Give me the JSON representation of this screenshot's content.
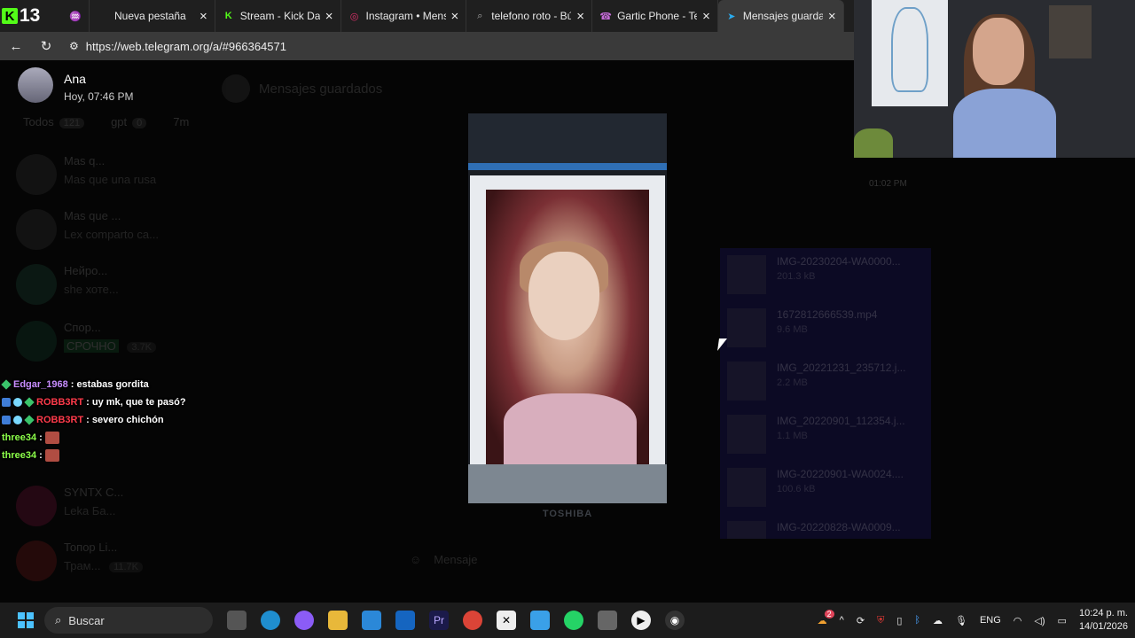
{
  "stream": {
    "kick_count": "13"
  },
  "tabs": [
    {
      "title": "Nueva pestaña",
      "icon": "new-tab-icon",
      "active": false
    },
    {
      "title": "Stream - Kick Dash",
      "icon": "kick-icon",
      "active": false
    },
    {
      "title": "Instagram • Mensa",
      "icon": "instagram-icon",
      "active": false
    },
    {
      "title": "telefono roto - Bús",
      "icon": "search-icon",
      "active": false
    },
    {
      "title": "Gartic Phone - Tele",
      "icon": "gartic-icon",
      "active": false
    },
    {
      "title": "Mensajes guardad",
      "icon": "telegram-icon",
      "active": true
    }
  ],
  "address_bar": {
    "url": "https://web.telegram.org/a/#966364571"
  },
  "notification": {
    "name": "Ana",
    "time": "Hoy, 07:46 PM"
  },
  "telegram": {
    "chat_title": "Mensajes guardados",
    "folders": [
      {
        "label": "Todos",
        "count": "121"
      },
      {
        "label": "gpt",
        "count": "0"
      },
      {
        "label": "7m",
        "count": ""
      }
    ],
    "chats": [
      {
        "name": "Mas q...",
        "message": "Mas que una rusa"
      },
      {
        "name": "Mas que ...",
        "message": "Lex comparto ca..."
      },
      {
        "name": "Нейро...",
        "message": "she хоте..."
      },
      {
        "name": "Спор...",
        "message": "СРОЧНО",
        "count": "3.7K"
      },
      {
        "name": "SYNTX C...",
        "message": "Leka Ба..."
      },
      {
        "name": "Топор Li...",
        "message": "Трам...",
        "count": "11.7K"
      }
    ],
    "message_placeholder": "Mensaje",
    "photo_brand": "TOSHIBA",
    "bg_time": "01:02 PM",
    "media": [
      {
        "name": "IMG-20230204-WA0000...",
        "size": "201.3 kB"
      },
      {
        "name": "1672812666539.mp4",
        "size": "9.6 MB"
      },
      {
        "name": "IMG_20221231_235712.j...",
        "size": "2.2 MB"
      },
      {
        "name": "IMG_20220901_112354.j...",
        "size": "1.1 MB"
      },
      {
        "name": "IMG-20220901-WA0024....",
        "size": "100.6 kB"
      },
      {
        "name": "IMG-20220828-WA0009...",
        "size": ""
      }
    ]
  },
  "chat_overlay": [
    {
      "user": "Edgar_1968",
      "user_color": "#c78dff",
      "message": "estabas gordita",
      "badges": [
        "gem"
      ]
    },
    {
      "user": "ROBB3RT",
      "user_color": "#ff3b4b",
      "message": "uy mk, que te pasó?",
      "badges": [
        "bdg",
        "bdg2",
        "gem"
      ]
    },
    {
      "user": "ROBB3RT",
      "user_color": "#ff3b4b",
      "message": "severo chichón",
      "badges": [
        "bdg",
        "bdg2",
        "gem"
      ]
    },
    {
      "user": "three34",
      "user_color": "#8cff4a",
      "message": "",
      "emote": true,
      "badges": []
    },
    {
      "user": "three34",
      "user_color": "#8cff4a",
      "message": "",
      "emote": true,
      "badges": []
    }
  ],
  "taskbar": {
    "search_placeholder": "Buscar",
    "language": "ENG",
    "time": "10:24 p. m.",
    "date": "14/01/2026",
    "notification_count": "2"
  }
}
